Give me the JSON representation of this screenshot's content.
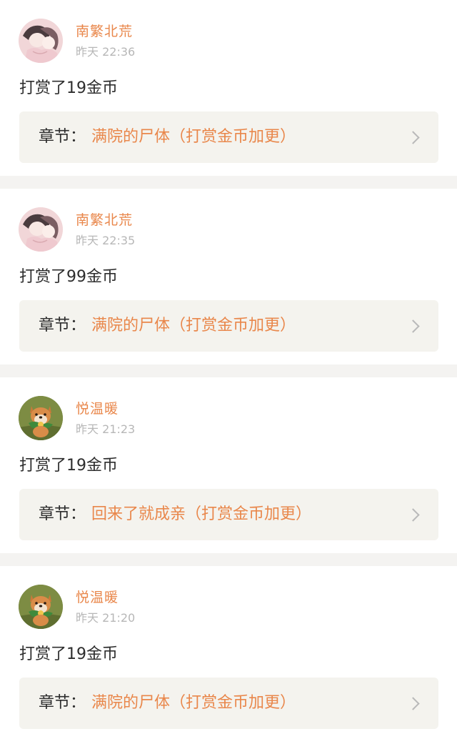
{
  "feed": {
    "items": [
      {
        "avatar": "anime-couple-avatar",
        "username": "南繁北荒",
        "time": "昨天 22:36",
        "action": "打赏了19金币",
        "chapter_label": "章节：",
        "chapter_title": "满院的尸体（打赏金币加更）"
      },
      {
        "avatar": "anime-couple-avatar",
        "username": "南繁北荒",
        "time": "昨天 22:35",
        "action": "打赏了99金币",
        "chapter_label": "章节：",
        "chapter_title": "满院的尸体（打赏金币加更）"
      },
      {
        "avatar": "shiba-dog-avatar",
        "username": "悦温暖",
        "time": "昨天 21:23",
        "action": "打赏了19金币",
        "chapter_label": "章节：",
        "chapter_title": "回来了就成亲（打赏金币加更）"
      },
      {
        "avatar": "shiba-dog-avatar",
        "username": "悦温暖",
        "time": "昨天 21:20",
        "action": "打赏了19金币",
        "chapter_label": "章节：",
        "chapter_title": "满院的尸体（打赏金币加更）"
      }
    ]
  },
  "colors": {
    "accent": "#e9874b",
    "text": "#2d2d2d",
    "muted": "#b7b7b7",
    "chapter_bg": "#f4f3ee",
    "page_bg": "#f4f3f1"
  }
}
